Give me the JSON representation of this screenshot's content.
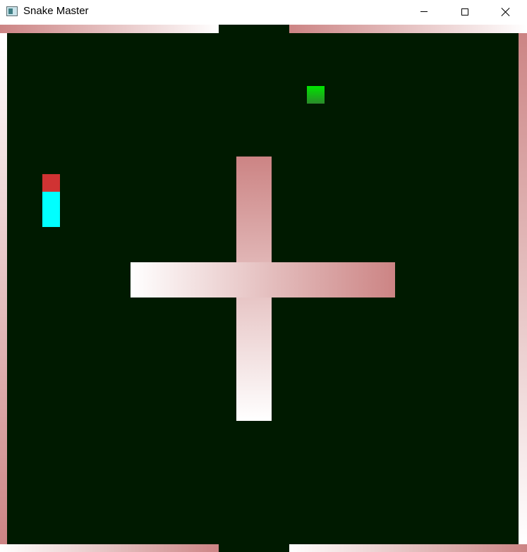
{
  "window": {
    "title": "Snake Master",
    "controls": {
      "minimize_icon": "minimize-icon",
      "maximize_icon": "maximize-icon",
      "close_icon": "close-icon"
    }
  },
  "game": {
    "colors": {
      "background": "#001a00",
      "wall_gradient_dark": "#cc8484",
      "wall_gradient_light": "#ffffff",
      "snake_head": "#d03333",
      "snake_body": "#00ffff",
      "food": "#00e600"
    }
  }
}
